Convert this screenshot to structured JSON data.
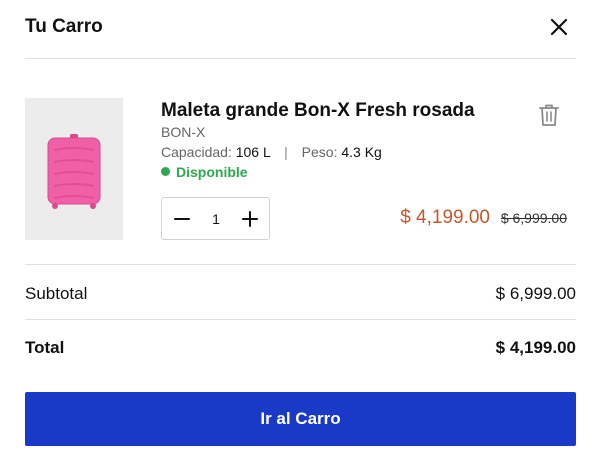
{
  "header": {
    "title": "Tu Carro",
    "close_icon": "close-icon"
  },
  "item": {
    "name": "Maleta grande Bon-X Fresh rosada",
    "brand": "BON-X",
    "capacity_label": "Capacidad:",
    "capacity_value": "106 L",
    "separator": "|",
    "weight_label": "Peso:",
    "weight_value": "4.3 Kg",
    "availability": "Disponible",
    "quantity": "1",
    "price_now": "$ 4,199.00",
    "price_was": "$ 6,999.00",
    "product_color": "#f060a6",
    "delete_icon": "trash-icon"
  },
  "summary": {
    "subtotal_label": "Subtotal",
    "subtotal_value": "$ 6,999.00",
    "total_label": "Total",
    "total_value": "$ 4,199.00"
  },
  "cta": {
    "label": "Ir al Carro",
    "color": "#1a39c7"
  },
  "colors": {
    "available": "#2ea84f",
    "sale_price": "#c4582a"
  }
}
